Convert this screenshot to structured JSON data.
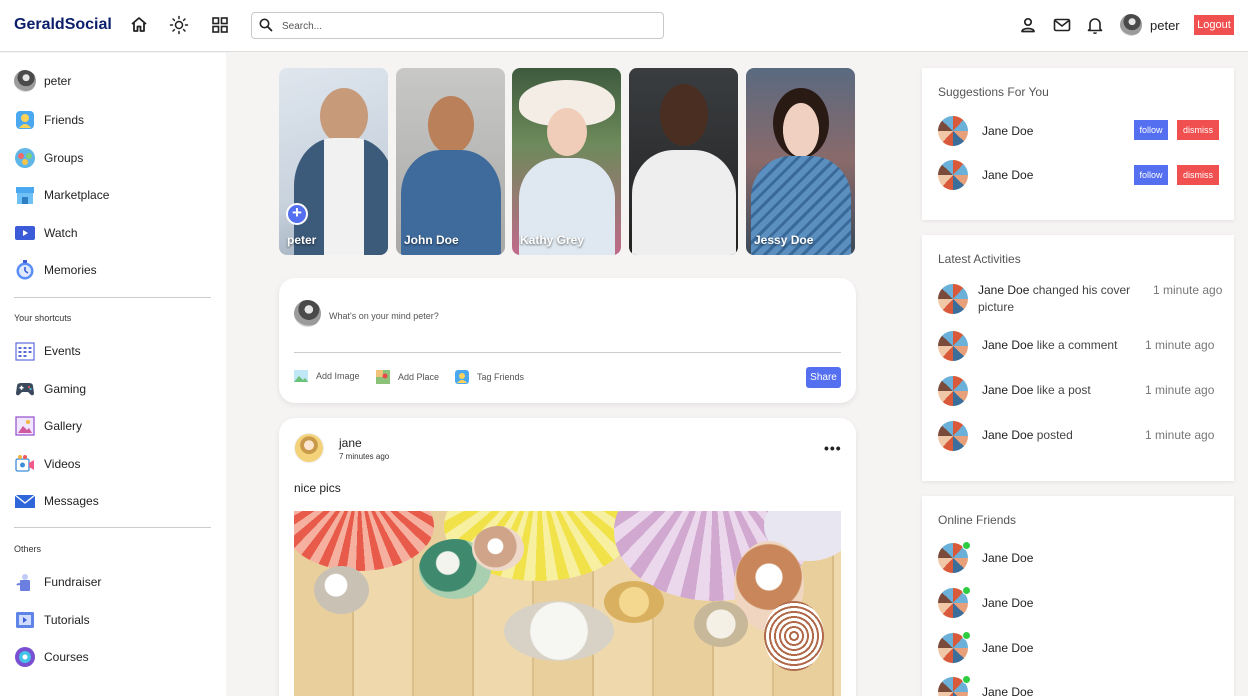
{
  "app": {
    "logo": "GeraldSocial"
  },
  "nav": {
    "search_placeholder": "Search...",
    "user_name": "peter",
    "logout_label": "Logout",
    "icons": [
      "home-icon",
      "theme-toggle-icon",
      "apps-grid-icon",
      "profile-icon",
      "mail-icon",
      "notifications-icon"
    ]
  },
  "sidebar": {
    "main": [
      {
        "label": "peter",
        "icon": "user-avatar"
      },
      {
        "label": "Friends",
        "icon": "friends-icon"
      },
      {
        "label": "Groups",
        "icon": "groups-icon"
      },
      {
        "label": "Marketplace",
        "icon": "marketplace-icon"
      },
      {
        "label": "Watch",
        "icon": "watch-icon"
      },
      {
        "label": "Memories",
        "icon": "memories-icon"
      }
    ],
    "shortcuts_heading": "Your shortcuts",
    "shortcuts": [
      {
        "label": "Events",
        "icon": "events-icon"
      },
      {
        "label": "Gaming",
        "icon": "gaming-icon"
      },
      {
        "label": "Gallery",
        "icon": "gallery-icon"
      },
      {
        "label": "Videos",
        "icon": "videos-icon"
      },
      {
        "label": "Messages",
        "icon": "messages-icon"
      }
    ],
    "others_heading": "Others",
    "others": [
      {
        "label": "Fundraiser",
        "icon": "fundraiser-icon"
      },
      {
        "label": "Tutorials",
        "icon": "tutorials-icon"
      },
      {
        "label": "Courses",
        "icon": "courses-icon"
      }
    ]
  },
  "stories": [
    {
      "name": "peter"
    },
    {
      "name": "John Doe"
    },
    {
      "name": "Kathy Grey"
    },
    {
      "name": ""
    },
    {
      "name": "Jessy Doe"
    }
  ],
  "composer": {
    "placeholder": "What's on your mind peter?",
    "add_image": "Add Image",
    "add_place": "Add Place",
    "tag_friends": "Tag Friends",
    "share_label": "Share"
  },
  "post": {
    "author": "jane",
    "time": "7 minutes ago",
    "text": "nice pics",
    "menu": "•••"
  },
  "suggestions": {
    "title": "Suggestions For You",
    "items": [
      {
        "name": "Jane Doe",
        "follow": "follow",
        "dismiss": "dismiss"
      },
      {
        "name": "Jane Doe",
        "follow": "follow",
        "dismiss": "dismiss"
      }
    ]
  },
  "activities": {
    "title": "Latest Activities",
    "items": [
      {
        "name": "Jane Doe",
        "action": "changed his cover picture",
        "time": "1 minute ago"
      },
      {
        "name": "Jane Doe",
        "action": "like a comment",
        "time": "1 minute ago"
      },
      {
        "name": "Jane Doe",
        "action": "like a post",
        "time": "1 minute ago"
      },
      {
        "name": "Jane Doe",
        "action": "posted",
        "time": "1 minute ago"
      }
    ]
  },
  "online": {
    "title": "Online Friends",
    "items": [
      {
        "name": "Jane Doe"
      },
      {
        "name": "Jane Doe"
      },
      {
        "name": "Jane Doe"
      },
      {
        "name": "Jane Doe"
      }
    ]
  },
  "colors": {
    "accent": "#5470f0",
    "danger": "#f0504f",
    "online": "#2ecc40",
    "logo": "#0b1f6b"
  }
}
